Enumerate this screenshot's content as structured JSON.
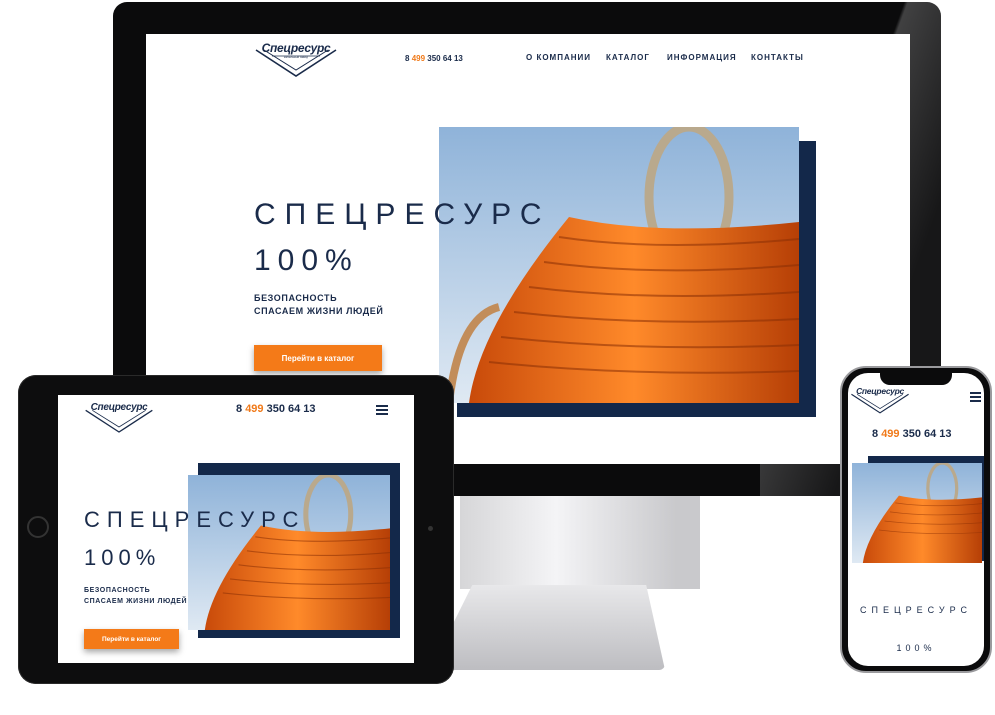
{
  "brand": {
    "logo_text": "Спецресурс",
    "logo_sub": "кабельный завод",
    "navy": "#13284a",
    "accent": "#f47a18"
  },
  "phone": {
    "prefix": "8",
    "code": "499",
    "number": "350 64 13"
  },
  "nav": [
    {
      "label": "О КОМПАНИИ"
    },
    {
      "label": "КАТАЛОГ"
    },
    {
      "label": "ИНФОРМАЦИЯ"
    },
    {
      "label": "КОНТАКТЫ"
    }
  ],
  "hero": {
    "title": "СПЕЦРЕСУРС",
    "percent": "100%",
    "subtitle_line1": "БЕЗОПАСНОСТЬ",
    "subtitle_line2": "СПАСАЕМ ЖИЗНИ ЛЮДЕЙ",
    "cta_label": "Перейти в каталог",
    "photo_icon": "orange-cable-reel"
  },
  "icons": {
    "menu": "hamburger-menu-icon"
  }
}
